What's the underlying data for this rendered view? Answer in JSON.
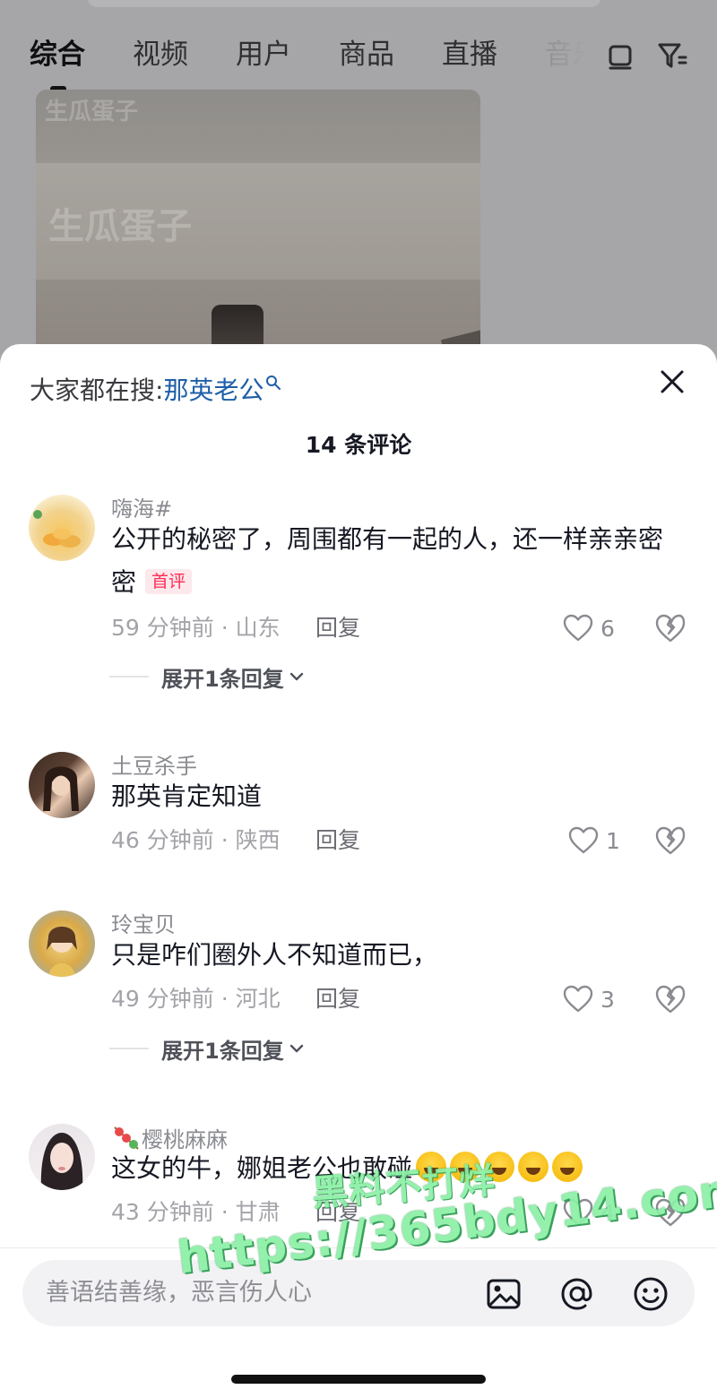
{
  "tabs": [
    {
      "label": "综合"
    },
    {
      "label": "视频"
    },
    {
      "label": "用户"
    },
    {
      "label": "商品"
    },
    {
      "label": "直播"
    },
    {
      "label": "音乐"
    }
  ],
  "thumbnail": {
    "watermark_text": "生瓜蛋子"
  },
  "sheet": {
    "hot_search_prefix": "大家都在搜:",
    "hot_search_term": "那英老公",
    "comment_count_title": "14 条评论"
  },
  "comments": [
    {
      "username": "嗨海#",
      "text": "公开的秘密了，周围都有一起的人，还一样亲亲密密",
      "badge": "首评",
      "time_location": "59 分钟前 · 山东",
      "reply_label": "回复",
      "likes": "6",
      "expand_label": "展开1条回复"
    },
    {
      "username": "土豆杀手",
      "text": "那英肯定知道",
      "time_location": "46 分钟前 · 陕西",
      "reply_label": "回复",
      "likes": "1"
    },
    {
      "username": "玲宝贝",
      "text": "只是咋们圈外人不知道而已，",
      "time_location": "49 分钟前 · 河北",
      "reply_label": "回复",
      "likes": "3",
      "expand_label": "展开1条回复"
    },
    {
      "username": "樱桃麻麻",
      "text": "这女的牛，娜姐老公也敢碰",
      "time_location": "43 分钟前 · 甘肃",
      "reply_label": "回复",
      "likes": "4"
    }
  ],
  "input": {
    "placeholder": "善语结善缘，恶言伤人心"
  },
  "watermark": {
    "line1": "黑料不打烊",
    "line2": "https://365bdy14.com"
  }
}
